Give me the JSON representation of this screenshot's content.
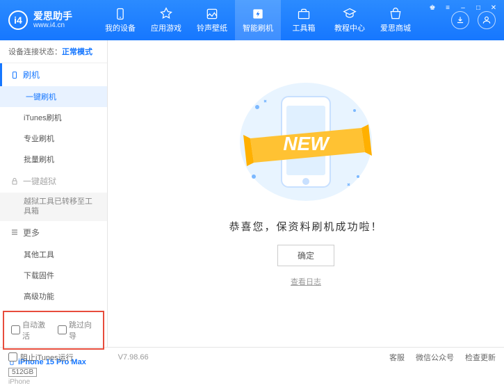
{
  "header": {
    "logo_title": "爱思助手",
    "logo_sub": "www.i4.cn",
    "nav": [
      {
        "label": "我的设备"
      },
      {
        "label": "应用游戏"
      },
      {
        "label": "铃声壁纸"
      },
      {
        "label": "智能刷机"
      },
      {
        "label": "工具箱"
      },
      {
        "label": "教程中心"
      },
      {
        "label": "爱思商城"
      }
    ]
  },
  "sidebar": {
    "status_label": "设备连接状态：",
    "status_mode": "正常模式",
    "section_flash": "刷机",
    "items_flash": [
      "一键刷机",
      "iTunes刷机",
      "专业刷机",
      "批量刷机"
    ],
    "section_jail": "一键越狱",
    "jail_note": "越狱工具已转移至工具箱",
    "section_more": "更多",
    "items_more": [
      "其他工具",
      "下载固件",
      "高级功能"
    ],
    "checkbox_auto": "自动激活",
    "checkbox_skip": "跳过向导",
    "device_name": "iPhone 15 Pro Max",
    "device_storage": "512GB",
    "device_type": "iPhone"
  },
  "main": {
    "banner_text": "NEW",
    "success_text": "恭喜您，保资料刷机成功啦！",
    "ok_button": "确定",
    "log_link": "查看日志"
  },
  "footer": {
    "block_itunes": "阻止iTunes运行",
    "version": "V7.98.66",
    "links": [
      "客服",
      "微信公众号",
      "检查更新"
    ]
  }
}
